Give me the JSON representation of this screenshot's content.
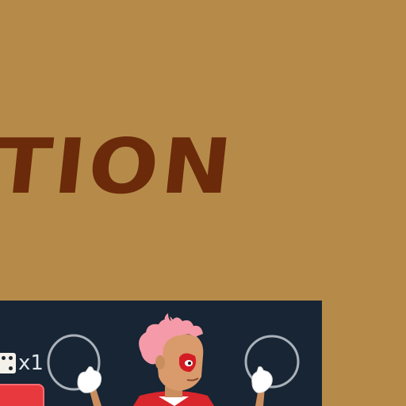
{
  "title": {
    "text": "TION"
  },
  "dice": {
    "count_label": "x1",
    "icon": "die-icon"
  },
  "colors": {
    "background": "#b68b4a",
    "title": "#6b2a09",
    "panel": "#172534",
    "button": "#e8393f",
    "hair": "#f59aa8",
    "skin": "#d99a6c",
    "eye": "#d41c24"
  },
  "character": {
    "name": "juggler-character"
  }
}
